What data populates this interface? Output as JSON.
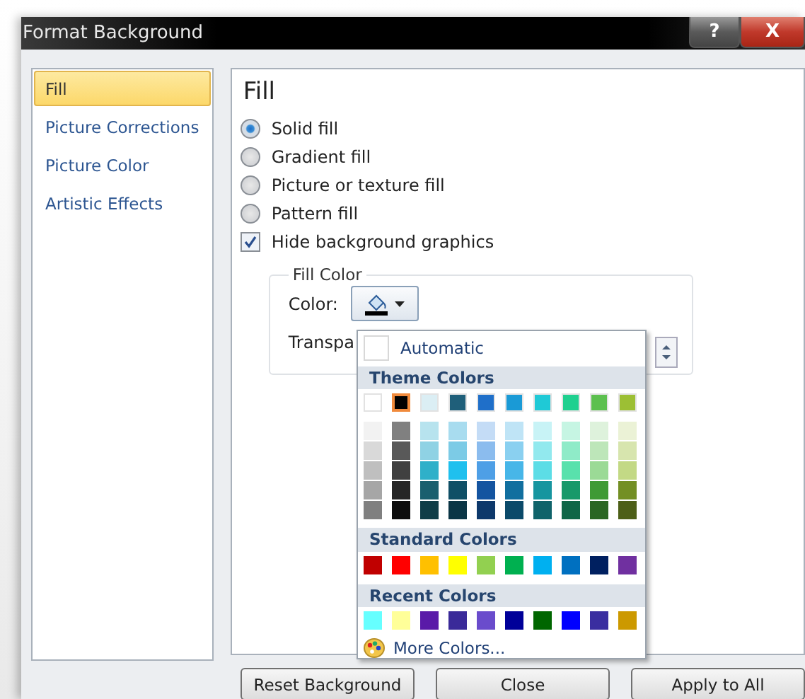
{
  "window": {
    "title": "Format Background",
    "help_button": "?",
    "close_button": "X"
  },
  "nav": [
    {
      "label": "Fill",
      "selected": true
    },
    {
      "label": "Picture Corrections",
      "selected": false
    },
    {
      "label": "Picture Color",
      "selected": false
    },
    {
      "label": "Artistic Effects",
      "selected": false
    }
  ],
  "panel": {
    "heading": "Fill",
    "options": [
      {
        "kind": "radio",
        "label": "Solid fill",
        "checked": true
      },
      {
        "kind": "radio",
        "label": "Gradient fill",
        "checked": false
      },
      {
        "kind": "radio",
        "label": "Picture or texture fill",
        "checked": false
      },
      {
        "kind": "radio",
        "label": "Pattern fill",
        "checked": false
      },
      {
        "kind": "checkbox",
        "label": "Hide background graphics",
        "checked": true
      }
    ],
    "group": {
      "legend": "Fill Color",
      "color_label": "Color:",
      "transparency_label": "Transpa"
    }
  },
  "color_menu": {
    "automatic": "Automatic",
    "theme_header": "Theme Colors",
    "theme": [
      {
        "color": "#ffffff",
        "selected": false,
        "shades": [
          {
            "color": "#f2f2f2"
          },
          {
            "color": "#d9d9d9"
          },
          {
            "color": "#bfbfbf"
          },
          {
            "color": "#a6a6a6"
          },
          {
            "color": "#808080"
          }
        ]
      },
      {
        "color": "#000000",
        "selected": true,
        "shades": [
          {
            "color": "#808080"
          },
          {
            "color": "#595959"
          },
          {
            "color": "#404040"
          },
          {
            "color": "#262626"
          },
          {
            "color": "#0d0d0d"
          }
        ]
      },
      {
        "color": "#dbeef4",
        "selected": false,
        "shades": [
          {
            "color": "#b7e3ee"
          },
          {
            "color": "#8fd2e4"
          },
          {
            "color": "#2fb0c9"
          },
          {
            "color": "#1a5f6e"
          },
          {
            "color": "#0f3d47"
          }
        ]
      },
      {
        "color": "#1f5f7a",
        "selected": false,
        "shades": [
          {
            "color": "#a8dcef"
          },
          {
            "color": "#7ccbe6"
          },
          {
            "color": "#1fc0ee"
          },
          {
            "color": "#0f4f66"
          },
          {
            "color": "#0a3545"
          }
        ]
      },
      {
        "color": "#1f6fc9",
        "selected": false,
        "shades": [
          {
            "color": "#c4dcf6"
          },
          {
            "color": "#8bbcee"
          },
          {
            "color": "#4e9fe6"
          },
          {
            "color": "#1454a0"
          },
          {
            "color": "#0d386b"
          }
        ]
      },
      {
        "color": "#1a9ad6",
        "selected": false,
        "shades": [
          {
            "color": "#bfe4f6"
          },
          {
            "color": "#8ad0f0"
          },
          {
            "color": "#47b6e8"
          },
          {
            "color": "#116f9f"
          },
          {
            "color": "#0b4a6a"
          }
        ]
      },
      {
        "color": "#1fc9d6",
        "selected": false,
        "shades": [
          {
            "color": "#c8f3f6"
          },
          {
            "color": "#92e9ee"
          },
          {
            "color": "#5cdde6"
          },
          {
            "color": "#16959f"
          },
          {
            "color": "#0f636a"
          }
        ]
      },
      {
        "color": "#1fd08f",
        "selected": false,
        "shades": [
          {
            "color": "#c6f5e3"
          },
          {
            "color": "#8febc8"
          },
          {
            "color": "#59e1ac"
          },
          {
            "color": "#17996a"
          },
          {
            "color": "#0f6647"
          }
        ]
      },
      {
        "color": "#5cc04f",
        "selected": false,
        "shades": [
          {
            "color": "#def2dc"
          },
          {
            "color": "#bde6b9"
          },
          {
            "color": "#9bda96"
          },
          {
            "color": "#3f9a35"
          },
          {
            "color": "#2a6623"
          }
        ]
      },
      {
        "color": "#9cbf34",
        "selected": false,
        "shades": [
          {
            "color": "#ebf2d6"
          },
          {
            "color": "#d7e5ae"
          },
          {
            "color": "#c3d985"
          },
          {
            "color": "#738f24"
          },
          {
            "color": "#4d5f18"
          }
        ]
      }
    ],
    "standard_header": "Standard Colors",
    "standard": [
      {
        "color": "#c00000"
      },
      {
        "color": "#ff0000"
      },
      {
        "color": "#ffc000"
      },
      {
        "color": "#ffff00"
      },
      {
        "color": "#92d050"
      },
      {
        "color": "#00b050"
      },
      {
        "color": "#00b0f0"
      },
      {
        "color": "#0070c0"
      },
      {
        "color": "#002060"
      },
      {
        "color": "#7030a0"
      }
    ],
    "recent_header": "Recent Colors",
    "recent": [
      {
        "color": "#66ffff"
      },
      {
        "color": "#ffff99"
      },
      {
        "color": "#5a1aa8"
      },
      {
        "color": "#3a2a99"
      },
      {
        "color": "#6a4ccc"
      },
      {
        "color": "#000099"
      },
      {
        "color": "#006600"
      },
      {
        "color": "#0000ff"
      },
      {
        "color": "#3a2ea0"
      },
      {
        "color": "#cc9900"
      }
    ],
    "more": "More Colors..."
  },
  "buttons": [
    "Reset Background",
    "Close",
    "Apply to All"
  ]
}
